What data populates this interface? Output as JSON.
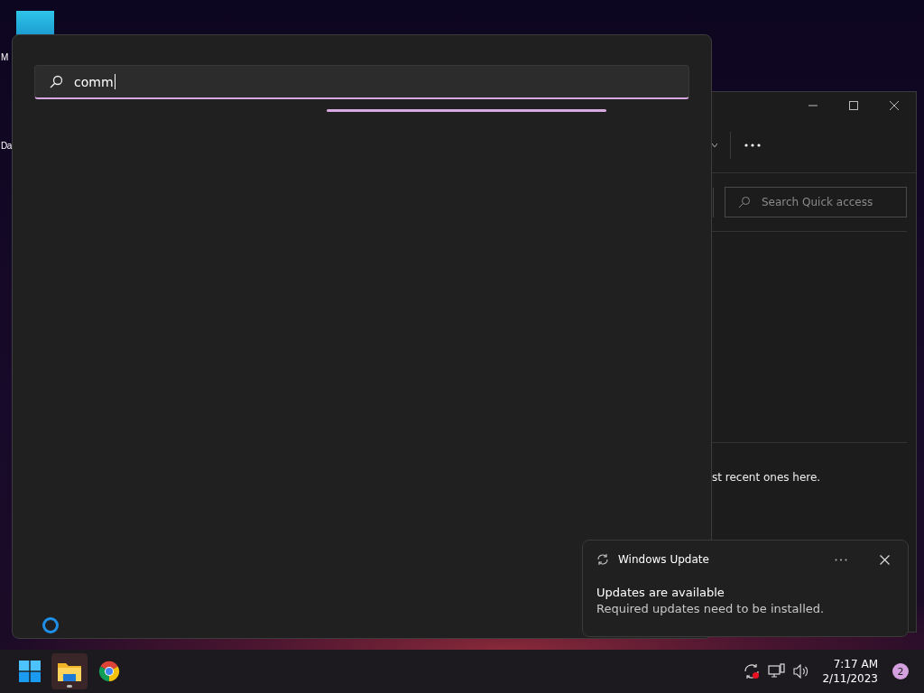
{
  "desktop_icons": [
    {
      "label": "M"
    },
    {
      "label": "Da"
    }
  ],
  "explorer": {
    "search": {
      "placeholder": "Search Quick access"
    },
    "message": "st recent ones here."
  },
  "search_panel": {
    "query": "comm"
  },
  "notification": {
    "app": "Windows Update",
    "title": "Updates are available",
    "body": "Required updates need to be installed."
  },
  "taskbar": {
    "apps": [
      {
        "kind": "start",
        "selected": false
      },
      {
        "kind": "explorer",
        "selected": true
      },
      {
        "kind": "chrome",
        "selected": false
      }
    ],
    "time": "7:17 AM",
    "date": "2/11/2023",
    "notification_count": "2"
  }
}
